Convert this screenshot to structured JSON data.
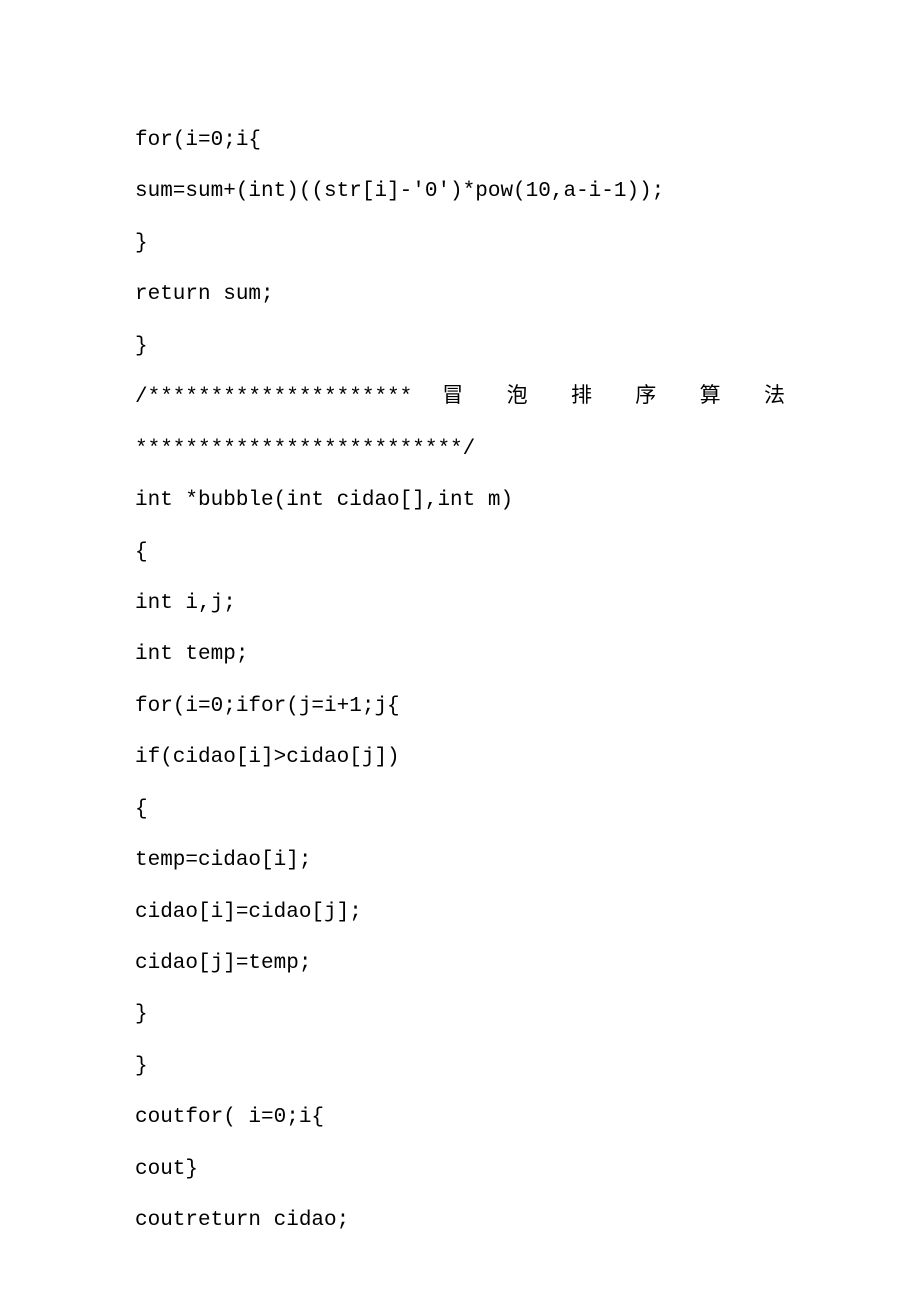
{
  "lines": {
    "l1": "for(i=0;i{",
    "l2": "sum=sum+(int)((str[i]-'0')*pow(10,a-i-1));",
    "l3": "}",
    "l4": "return sum;",
    "l5": "}",
    "l6_left": "/*********************",
    "l6_c1": "冒",
    "l6_c2": "泡",
    "l6_c3": "排",
    "l6_c4": "序",
    "l6_c5": "算",
    "l6_c6": "法",
    "l7": "**************************/",
    "l8": "int *bubble(int cidao[],int m)",
    "l9": "{",
    "l10": "int i,j;",
    "l11": "int temp;",
    "l12": "for(i=0;ifor(j=i+1;j{",
    "l13": "if(cidao[i]>cidao[j])",
    "l14": "{",
    "l15": "temp=cidao[i];",
    "l16": "cidao[i]=cidao[j];",
    "l17": "cidao[j]=temp;",
    "l18": "}",
    "l19": "}",
    "l20": "coutfor( i=0;i{",
    "l21": "cout}",
    "l22": "coutreturn cidao;"
  }
}
